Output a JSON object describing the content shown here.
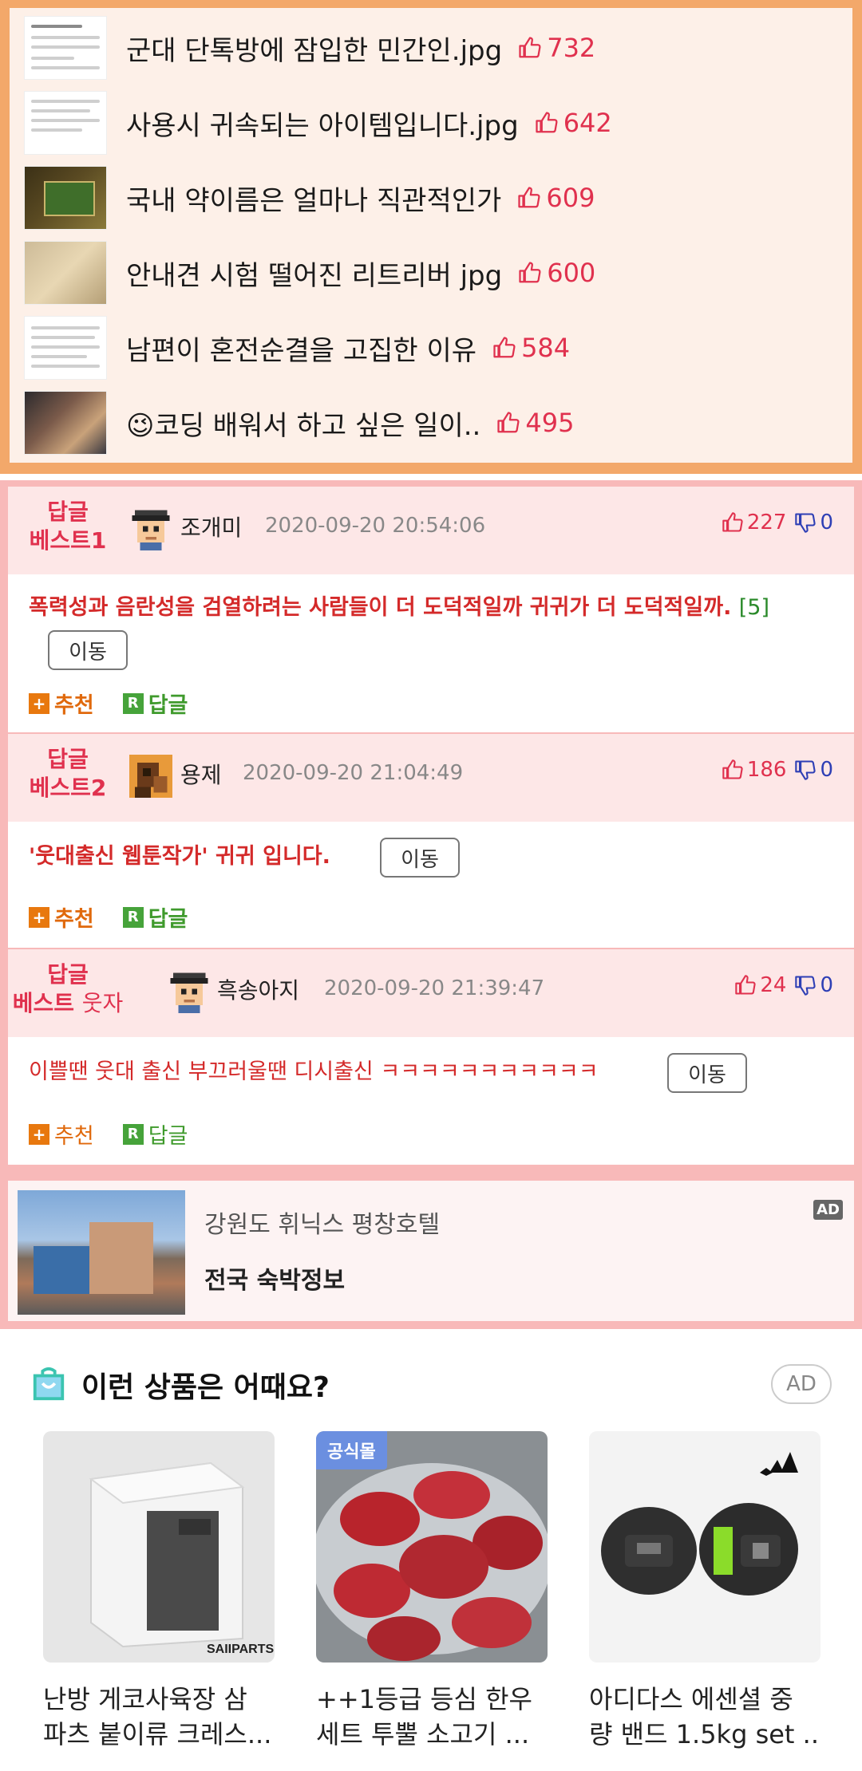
{
  "best_list": [
    {
      "title": "군대 단톡방에 잠입한 민간인.jpg",
      "likes": "732",
      "thumb": "text-doc"
    },
    {
      "title": "사용시 귀속되는 아이템입니다.jpg",
      "likes": "642",
      "thumb": "text-doc"
    },
    {
      "title": "국내 약이름은 얼마나 직관적인가",
      "likes": "609",
      "thumb": "photo-green"
    },
    {
      "title": "안내견 시험 떨어진 리트리버 jpg",
      "likes": "600",
      "thumb": "photo-dog"
    },
    {
      "title": "남편이 혼전순결을 고집한 이유",
      "likes": "584",
      "thumb": "text-doc"
    },
    {
      "title": "😉코딩 배워서 하고 싶은 일이..",
      "likes": "495",
      "thumb": "photo-room"
    }
  ],
  "replies": [
    {
      "label_top": "답글",
      "label_bottom": "베스트",
      "label_suffix": "1",
      "nick": "조개미",
      "date": "2020-09-20 20:54:06",
      "up": "227",
      "down": "0",
      "text": "폭력성과 음란성을 검열하려는 사람들이 더 도덕적일까 귀귀가 더 도덕적일까.",
      "count": "[5]",
      "move": "이동",
      "recommend": "추천",
      "reply": "답글"
    },
    {
      "label_top": "답글",
      "label_bottom": "베스트",
      "label_suffix": "2",
      "nick": "용제",
      "date": "2020-09-20 21:04:49",
      "up": "186",
      "down": "0",
      "text": "'웃대출신 웹툰작가' 귀귀 입니다.",
      "move": "이동",
      "recommend": "추천",
      "reply": "답글"
    },
    {
      "label_top": "답글",
      "label_bottom": "베스트",
      "label_suffix": "웃자",
      "nick": "흑송아지",
      "date": "2020-09-20 21:39:47",
      "up": "24",
      "down": "0",
      "text": "이쁠땐 웃대 출신 부끄러울땐 디시출신 ㅋㅋㅋㅋㅋㅋㅋㅋㅋㅋㅋ",
      "move": "이동",
      "recommend": "추천",
      "reply": "답글"
    }
  ],
  "lodging_ad": {
    "title": "강원도 휘닉스 평창호텔",
    "subtitle": "전국 숙박정보",
    "ad_tag": "AD"
  },
  "products": {
    "header": "이런 상품은 어때요?",
    "ad_label": "AD",
    "items": [
      {
        "name_line1": "난방 게코사육장 삼",
        "name_line2": "파츠 붙이류 크레스...",
        "brand_mark": "SAIIPARTS"
      },
      {
        "name_line1": "++1등급 등심 한우",
        "name_line2": "세트 투뿔 소고기 ...",
        "badge": "공식몰"
      },
      {
        "name_line1": "아디다스 에센셜 중",
        "name_line2": "량 밴드 1.5kg set ..."
      }
    ]
  },
  "colors": {
    "like_red": "#e0314e",
    "dislike_blue": "#2e3fb5",
    "best_panel_border": "#f3a86a",
    "reply_border": "#f8b9b9",
    "recommend_orange": "#e8780e",
    "reply_green": "#46a33a"
  }
}
